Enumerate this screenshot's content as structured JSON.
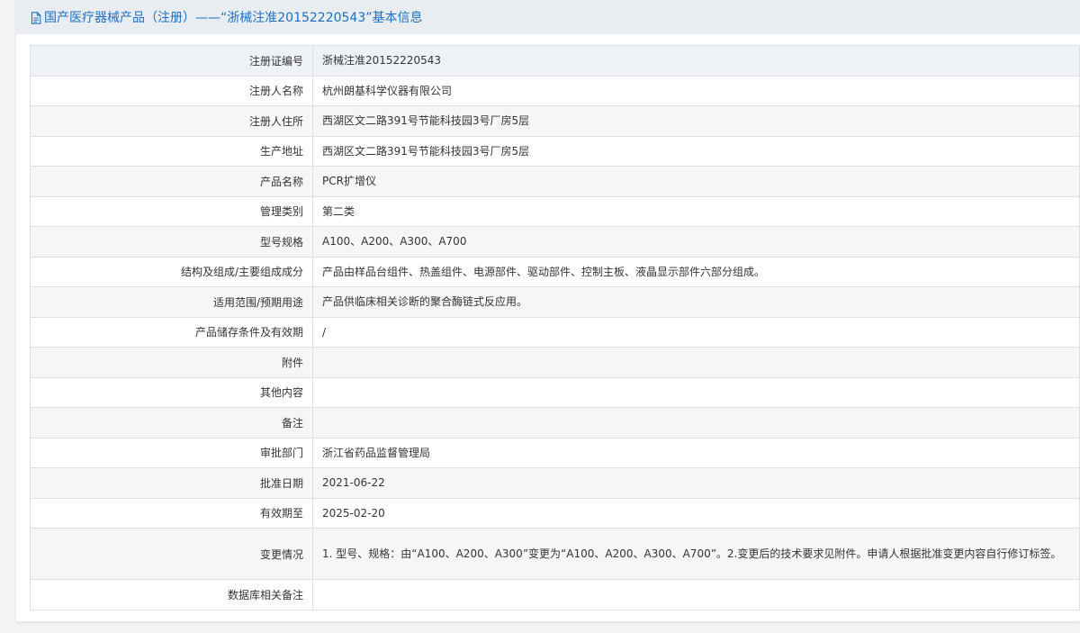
{
  "title": "国产医疗器械产品（注册）——“浙械注准20152220543”基本信息",
  "rows": [
    {
      "label": "注册证编号",
      "value": "浙械注准20152220543"
    },
    {
      "label": "注册人名称",
      "value": "杭州朗基科学仪器有限公司"
    },
    {
      "label": "注册人住所",
      "value": "西湖区文二路391号节能科技园3号厂房5层"
    },
    {
      "label": "生产地址",
      "value": "西湖区文二路391号节能科技园3号厂房5层"
    },
    {
      "label": "产品名称",
      "value": "PCR扩增仪"
    },
    {
      "label": "管理类别",
      "value": "第二类"
    },
    {
      "label": "型号规格",
      "value": "A100、A200、A300、A700"
    },
    {
      "label": "结构及组成/主要组成成分",
      "value": "产品由样品台组件、热盖组件、电源部件、驱动部件、控制主板、液晶显示部件六部分组成。"
    },
    {
      "label": "适用范围/预期用途",
      "value": "产品供临床相关诊断的聚合酶链式反应用。"
    },
    {
      "label": "产品储存条件及有效期",
      "value": "/"
    },
    {
      "label": "附件",
      "value": ""
    },
    {
      "label": "其他内容",
      "value": ""
    },
    {
      "label": "备注",
      "value": ""
    },
    {
      "label": "审批部门",
      "value": "浙江省药品监督管理局"
    },
    {
      "label": "批准日期",
      "value": "2021-06-22"
    },
    {
      "label": "有效期至",
      "value": "2025-02-20"
    },
    {
      "label": "变更情况",
      "value": "1. 型号、规格：由“A100、A200、A300”变更为“A100、A200、A300、A700”。2.变更后的技术要求见附件。申请人根据批准变更内容自行修订标签。"
    },
    {
      "label": "数据库相关备注",
      "value": ""
    }
  ],
  "icons": {
    "title": "document-icon"
  },
  "colors": {
    "title": "#1a6fc4",
    "title_bar": "#e9edf1",
    "border": "#dcdfe3"
  }
}
